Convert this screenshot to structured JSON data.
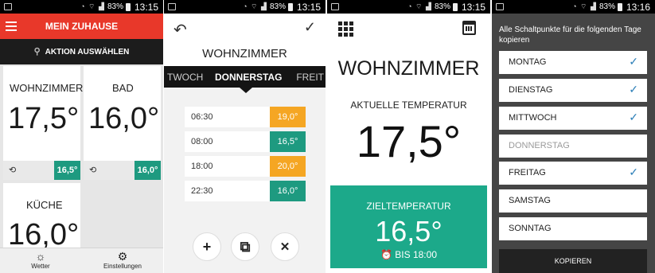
{
  "status": {
    "s1": {
      "signal": "83%",
      "time": "13:15"
    },
    "s2": {
      "signal": "83%",
      "time": "13:15"
    },
    "s3": {
      "signal": "83%",
      "time": "13:15"
    },
    "s4": {
      "signal": "83%",
      "time": "13:16"
    }
  },
  "home": {
    "title": "MEIN ZUHAUSE",
    "action": "AKTION AUSWÄHLEN",
    "rooms": [
      {
        "name": "WOHNZIMMER",
        "temp": "17,5°",
        "target": "16,5°"
      },
      {
        "name": "BAD",
        "temp": "16,0°",
        "target": "16,0°"
      },
      {
        "name": "KÜCHE",
        "temp": "16,0°"
      }
    ],
    "nav": [
      {
        "label": "Wetter",
        "icon": "weather-icon"
      },
      {
        "label": "Einstellungen",
        "icon": "gear-icon"
      }
    ],
    "colors": {
      "header": "#e8382a",
      "target_badge": "#1e9a80"
    }
  },
  "schedule": {
    "title": "WOHNZIMMER",
    "days": {
      "prev": "TWOCH",
      "current": "DONNERSTAG",
      "next": "FREIT"
    },
    "rows": [
      {
        "time": "06:30",
        "temp": "19,0°",
        "color": "#f5a623"
      },
      {
        "time": "08:00",
        "temp": "16,5°",
        "color": "#1e9a80"
      },
      {
        "time": "18:00",
        "temp": "20,0°",
        "color": "#f5a623"
      },
      {
        "time": "22:30",
        "temp": "16,0°",
        "color": "#1e9a80"
      }
    ],
    "buttons": [
      {
        "name": "add-button",
        "glyph": "+"
      },
      {
        "name": "copy-button",
        "glyph": "⧉"
      },
      {
        "name": "delete-button",
        "glyph": "✕"
      }
    ]
  },
  "room_detail": {
    "room": "WOHNZIMMER",
    "current_label": "AKTUELLE TEMPERATUR",
    "current_temp": "17,5°",
    "target_label": "ZIELTEMPERATUR",
    "target_temp": "16,5°",
    "until": "BIS 18:00",
    "colors": {
      "target_panel": "#1ca98a"
    }
  },
  "copy_dialog": {
    "title": "Alle Schaltpunkte für die folgenden Tage kopieren",
    "days": [
      {
        "name": "MONTAG",
        "checked": true,
        "disabled": false
      },
      {
        "name": "DIENSTAG",
        "checked": true,
        "disabled": false
      },
      {
        "name": "MITTWOCH",
        "checked": true,
        "disabled": false
      },
      {
        "name": "DONNERSTAG",
        "checked": false,
        "disabled": true
      },
      {
        "name": "FREITAG",
        "checked": true,
        "disabled": false
      },
      {
        "name": "SAMSTAG",
        "checked": false,
        "disabled": false
      },
      {
        "name": "SONNTAG",
        "checked": false,
        "disabled": false
      }
    ],
    "button": "KOPIEREN",
    "colors": {
      "check": "#2d7fb8"
    }
  }
}
